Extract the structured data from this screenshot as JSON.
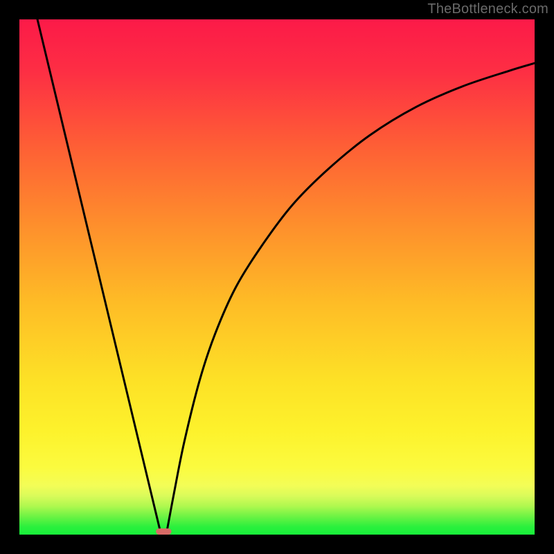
{
  "watermark": "TheBottleneck.com",
  "chart_data": {
    "type": "line",
    "title": "",
    "xlabel": "",
    "ylabel": "",
    "xlim": [
      0,
      100
    ],
    "ylim": [
      0,
      100
    ],
    "grid": false,
    "legend": false,
    "background_gradient": {
      "top": "#fc1848",
      "mid": "#fded26",
      "green_band": "#33ee3e",
      "bottom_band_start_y": 95,
      "bottom_green_peak_y": 100
    },
    "series": [
      {
        "name": "left-branch",
        "x": [
          3.5,
          27.5
        ],
        "y": [
          100,
          0
        ],
        "style": "line"
      },
      {
        "name": "right-branch",
        "x": [
          28.5,
          30,
          32,
          35,
          38,
          42,
          47,
          53,
          60,
          68,
          77,
          86,
          95,
          100
        ],
        "y": [
          0,
          8,
          18,
          30,
          39,
          48,
          56,
          64,
          71,
          77.5,
          83,
          87,
          90,
          91.5
        ],
        "style": "curve"
      }
    ],
    "minimum_marker": {
      "x": 28,
      "y": 0,
      "color": "#d86a66",
      "width": 3,
      "height": 1.2
    }
  }
}
